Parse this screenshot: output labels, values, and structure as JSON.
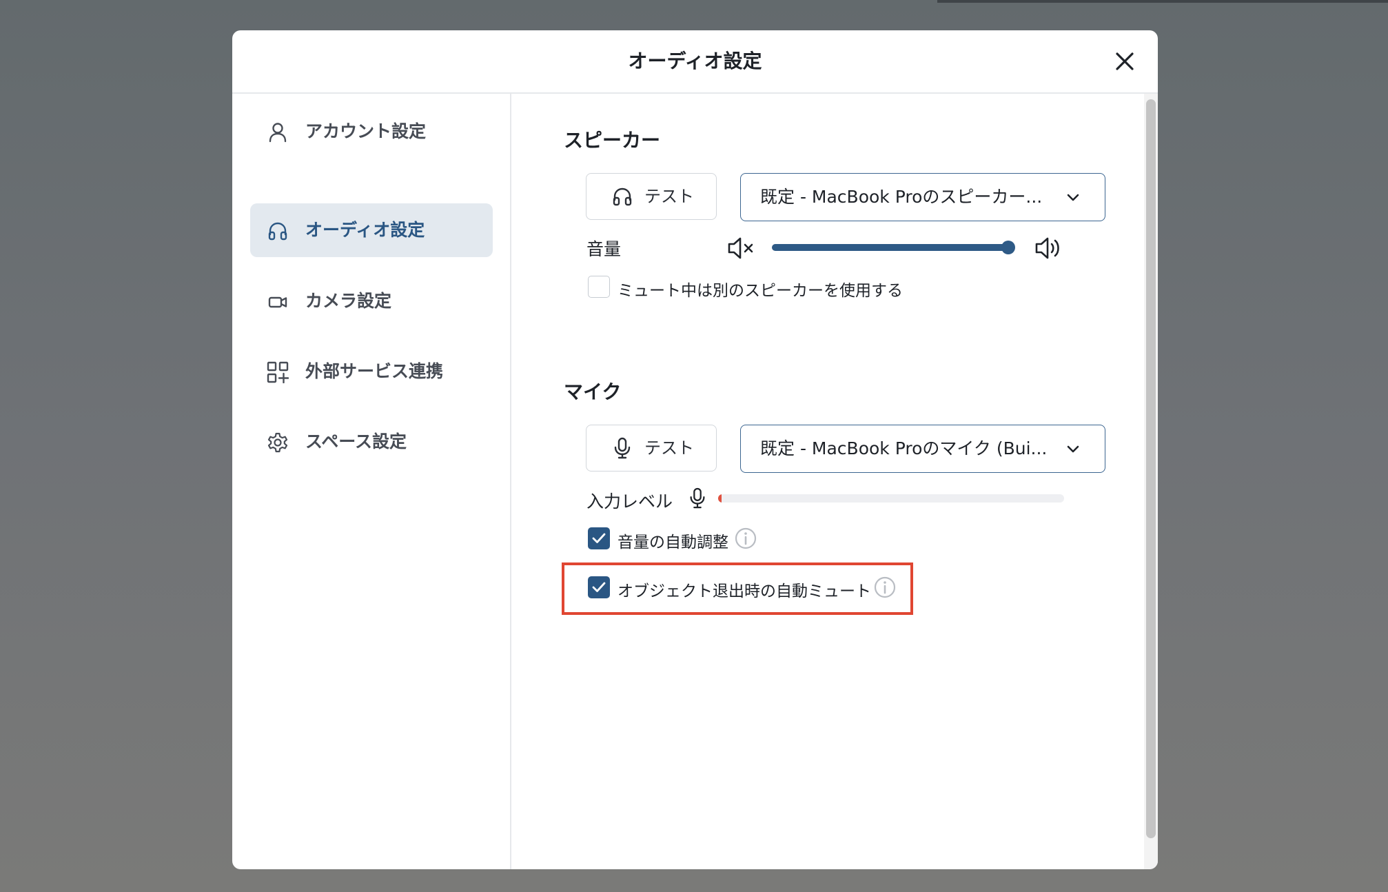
{
  "dialog": {
    "title": "オーディオ設定"
  },
  "sidebar": {
    "items": [
      {
        "label": "アカウント設定",
        "icon": "user-icon",
        "active": false
      },
      {
        "label": "オーディオ設定",
        "icon": "headphones-icon",
        "active": true
      },
      {
        "label": "カメラ設定",
        "icon": "video-camera-icon",
        "active": false
      },
      {
        "label": "外部サービス連携",
        "icon": "apps-add-icon",
        "active": false
      },
      {
        "label": "スペース設定",
        "icon": "gear-icon",
        "active": false
      }
    ]
  },
  "speaker": {
    "title": "スピーカー",
    "test_label": "テスト",
    "device": "既定 - MacBook Proのスピーカー...",
    "volume_label": "音量",
    "volume_level": 0.98,
    "mute_alt_label": "ミュート中は別のスピーカーを使用する",
    "mute_alt_checked": false
  },
  "mic": {
    "title": "マイク",
    "test_label": "テスト",
    "device": "既定 - MacBook Proのマイク (Bui...",
    "input_level_label": "入力レベル",
    "input_level": 0.01,
    "auto_gain_label": "音量の自動調整",
    "auto_gain_checked": true,
    "auto_mute_label": "オブジェクト退出時の自動ミュート",
    "auto_mute_checked": true
  },
  "colors": {
    "accent": "#2a5683",
    "highlight": "#e04632",
    "level": "#e0503e"
  }
}
